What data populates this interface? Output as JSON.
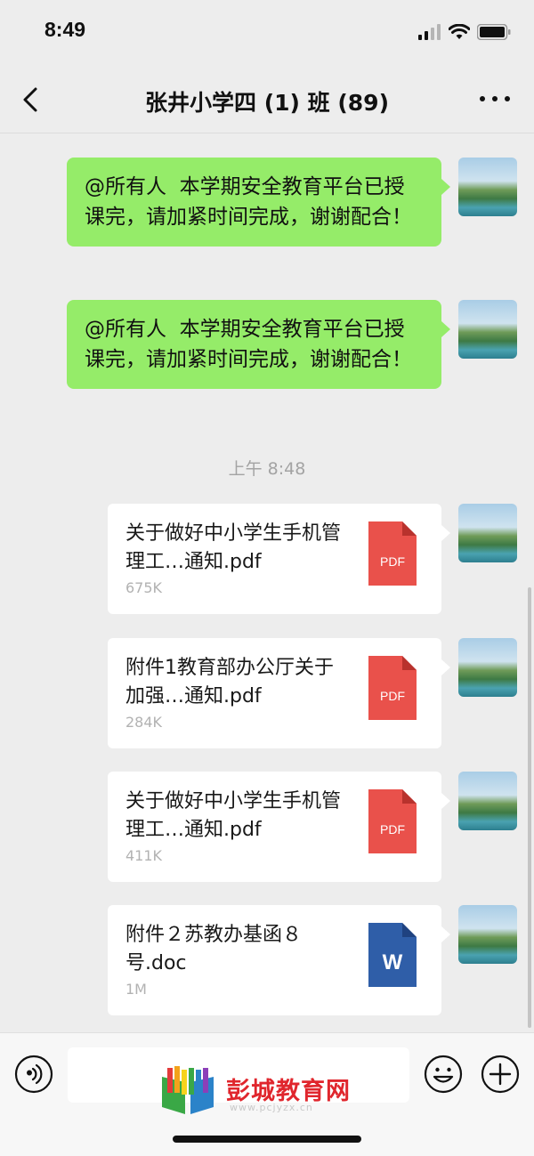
{
  "status_bar": {
    "time": "8:49"
  },
  "nav": {
    "title": "张井小学四 (1) 班 (89)"
  },
  "messages": [
    {
      "type": "text",
      "content": "@所有人  本学期安全教育平台已授课完，请加紧时间完成，谢谢配合！"
    },
    {
      "type": "text",
      "content": "@所有人  本学期安全教育平台已授课完，请加紧时间完成，谢谢配合！"
    }
  ],
  "timestamp": "上午 8:48",
  "files": [
    {
      "name": "关于做好中小学生手机管理工…通知.pdf",
      "size": "675K",
      "icon": "pdf-icon",
      "icon_label": "PDF",
      "icon_color": "#e9514b"
    },
    {
      "name": "附件1教育部办公厅关于加强…通知.pdf",
      "size": "284K",
      "icon": "pdf-icon",
      "icon_label": "PDF",
      "icon_color": "#e9514b"
    },
    {
      "name": "关于做好中小学生手机管理工…通知.pdf",
      "size": "411K",
      "icon": "pdf-icon",
      "icon_label": "PDF",
      "icon_color": "#e9514b"
    },
    {
      "name": "附件２苏教办基函８号.doc",
      "size": "1M",
      "icon": "word-icon",
      "icon_label": "W",
      "icon_color": "#2f5ea8"
    }
  ],
  "watermark": {
    "text": "彭城教育网",
    "url": "www.pcjyzx.cn"
  },
  "colors": {
    "bubble_green": "#95ec69",
    "background": "#ededed",
    "pdf_red": "#e9514b",
    "word_blue": "#2f5ea8"
  }
}
